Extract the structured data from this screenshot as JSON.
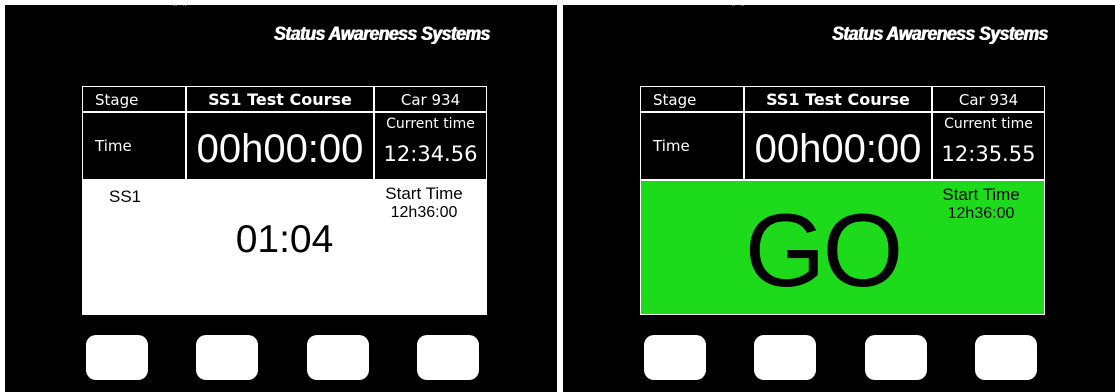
{
  "brand": "Status Awareness Systems",
  "screens": [
    {
      "stage_label": "Stage",
      "course": "SS1 Test Course",
      "car": "Car 934",
      "time_label": "Time",
      "elapsed": "00h00:00",
      "current_time_label": "Current time",
      "current_time": "12:34.56",
      "stage_code": "SS1",
      "start_time_label": "Start Time",
      "start_time": "12h36:00",
      "countdown": "01:04",
      "panel_color": "#ffffff"
    },
    {
      "stage_label": "Stage",
      "course": "SS1 Test Course",
      "car": "Car 934",
      "time_label": "Time",
      "elapsed": "00h00:00",
      "current_time_label": "Current time",
      "current_time": "12:35.55",
      "start_time_label": "Start Time",
      "start_time": "12h36:00",
      "go": "GO",
      "panel_color": "#1ddb1a"
    }
  ]
}
